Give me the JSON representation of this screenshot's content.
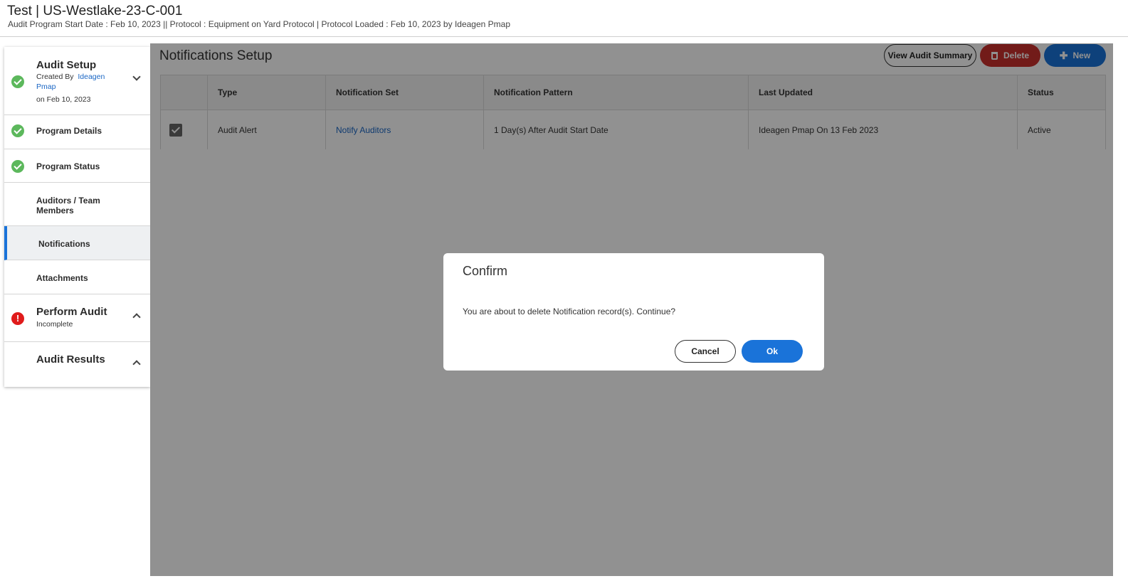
{
  "header": {
    "title": "Test | US-Westlake-23-C-001",
    "subtitle": "Audit Program Start Date : Feb 10, 2023 || Protocol : Equipment on Yard Protocol | Protocol Loaded : Feb 10, 2023 by Ideagen Pmap"
  },
  "sidebar": {
    "audit_setup": {
      "title": "Audit Setup",
      "created_by_label": "Created By",
      "created_by_user": "Ideagen Pmap",
      "created_on": "on Feb 10, 2023"
    },
    "items": [
      {
        "label": "Program Details",
        "status": "complete"
      },
      {
        "label": "Program Status",
        "status": "complete"
      },
      {
        "label": "Auditors / Team Members",
        "status": "none"
      },
      {
        "label": "Notifications",
        "status": "active"
      },
      {
        "label": "Attachments",
        "status": "none"
      }
    ],
    "perform_audit": {
      "title": "Perform Audit",
      "status": "Incomplete"
    },
    "audit_results": {
      "title": "Audit Results"
    }
  },
  "main": {
    "title": "Notifications Setup",
    "buttons": {
      "view_summary": "View Audit Summary",
      "delete": "Delete",
      "new": "New"
    },
    "table": {
      "columns": [
        "Type",
        "Notification Set",
        "Notification Pattern",
        "Last Updated",
        "Status"
      ],
      "rows": [
        {
          "checked": true,
          "type": "Audit Alert",
          "notification_set": "Notify Auditors",
          "pattern": "1 Day(s) After Audit Start Date",
          "last_updated": "Ideagen Pmap On 13 Feb 2023",
          "status": "Active"
        }
      ]
    }
  },
  "modal": {
    "title": "Confirm",
    "message": "You are about to delete Notification record(s). Continue?",
    "cancel_label": "Cancel",
    "ok_label": "Ok"
  },
  "colors": {
    "primary": "#1a73d9",
    "danger": "#c9302c",
    "success": "#5cb85c",
    "error": "#e01b1b"
  }
}
